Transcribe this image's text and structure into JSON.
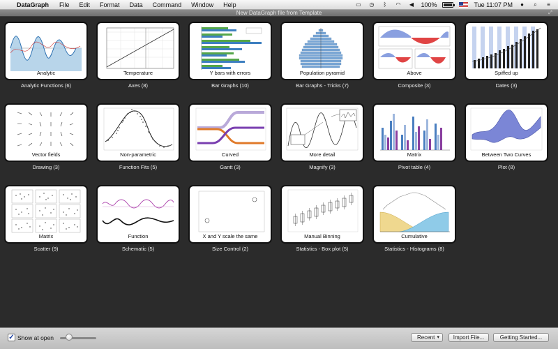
{
  "menubar": {
    "app_name": "DataGraph",
    "items": [
      "File",
      "Edit",
      "Format",
      "Data",
      "Command",
      "Window",
      "Help"
    ],
    "battery": "100%",
    "clock": "Tue 11:07 PM"
  },
  "window": {
    "title": "New DataGraph file from Template"
  },
  "templates": [
    {
      "label": "Analytic",
      "category": "Analytic Functions (6)"
    },
    {
      "label": "Temperature",
      "category": "Axes (8)"
    },
    {
      "label": "Y bars with errors",
      "category": "Bar Graphs (10)"
    },
    {
      "label": "Population pyramid",
      "category": "Bar Graphs - Tricks (7)"
    },
    {
      "label": "Above",
      "category": "Composite (3)"
    },
    {
      "label": "Spiffed up",
      "category": "Dates (3)"
    },
    {
      "label": "Vector fields",
      "category": "Drawing (3)"
    },
    {
      "label": "Non-parametric",
      "category": "Function Fits (5)"
    },
    {
      "label": "Curved",
      "category": "Gantt (3)"
    },
    {
      "label": "More detail",
      "category": "Magnify (3)"
    },
    {
      "label": "Matrix",
      "category": "Pivot table (4)"
    },
    {
      "label": "Between Two Curves",
      "category": "Plot (8)"
    },
    {
      "label": "Matrix",
      "category": "Scatter (9)"
    },
    {
      "label": "Function",
      "category": "Schematic (5)"
    },
    {
      "label": "X and Y scale the same",
      "category": "Size Control (2)"
    },
    {
      "label": "Manual Binning",
      "category": "Statistics - Box plot (5)"
    },
    {
      "label": "Cumulative",
      "category": "Statistics - Histograms (8)"
    }
  ],
  "bottom": {
    "show_at_open": "Show at open",
    "show_at_open_checked": true,
    "recent": "Recent",
    "import": "Import File...",
    "getting_started": "Getting Started..."
  },
  "colors": {
    "background": "#2b2b2b",
    "accent_blue": "#4a7fc0"
  }
}
